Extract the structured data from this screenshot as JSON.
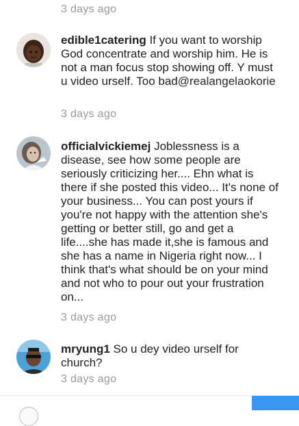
{
  "top_timestamp": "3 days ago",
  "comments": [
    {
      "username": "edible1catering",
      "text": " If you want to worship God concentrate and worship him. He is not a man focus stop showing off. Y must u video urself. Too bad",
      "mention": "@realangelaokorie",
      "timestamp": "3 days ago",
      "avatar_icon": "profile-photo-child"
    },
    {
      "username": "officialvickiemej",
      "text": " Joblessness is a disease, see how some people are seriously criticizing her.... Ehn what is there if she posted this video... It's none of your business... You can post yours if you're not happy with the attention she's getting or better still, go and get  a life....she has made it,she is famous and she has a name in Nigeria right now... I think that's what should be on your mind and not who to pour out your frustration on...",
      "mention": "",
      "timestamp": "3 days ago",
      "avatar_icon": "profile-photo-woman"
    },
    {
      "username": "mryung1",
      "text": " So u dey video urself for church?",
      "mention": "",
      "timestamp": "3 days ago",
      "avatar_icon": "profile-photo-man-sunglasses"
    }
  ],
  "colors": {
    "timestamp": "#9a9a9a",
    "text": "#222222",
    "post_button": "#3897f0"
  }
}
